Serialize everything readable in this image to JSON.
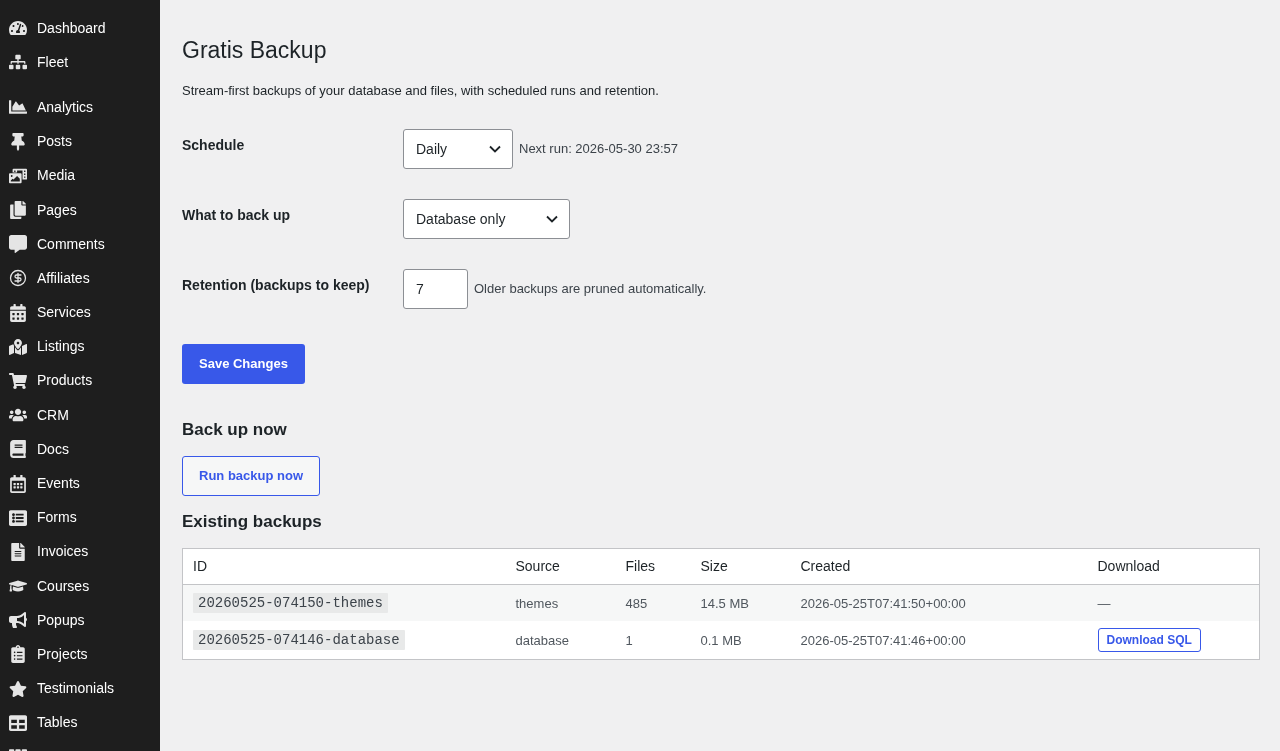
{
  "sidebar": {
    "groups": [
      {
        "items": [
          {
            "label": "Dashboard",
            "selected": false
          },
          {
            "label": "Fleet",
            "selected": false
          }
        ]
      },
      {
        "items": [
          {
            "label": "Analytics",
            "selected": false
          },
          {
            "label": "Posts",
            "selected": false
          },
          {
            "label": "Media",
            "selected": false
          },
          {
            "label": "Pages",
            "selected": false
          },
          {
            "label": "Comments",
            "selected": false
          },
          {
            "label": "Affiliates",
            "selected": false
          },
          {
            "label": "Services",
            "selected": false
          },
          {
            "label": "Listings",
            "selected": false
          },
          {
            "label": "Products",
            "selected": false
          },
          {
            "label": "CRM",
            "selected": false
          },
          {
            "label": "Docs",
            "selected": false
          },
          {
            "label": "Events",
            "selected": false
          },
          {
            "label": "Forms",
            "selected": false
          },
          {
            "label": "Invoices",
            "selected": false
          },
          {
            "label": "Courses",
            "selected": false
          },
          {
            "label": "Popups",
            "selected": false
          },
          {
            "label": "Projects",
            "selected": false
          },
          {
            "label": "Testimonials",
            "selected": false
          },
          {
            "label": "Tables",
            "selected": false
          }
        ]
      }
    ]
  },
  "page": {
    "title": "Gratis Backup",
    "description": "Stream-first backups of your database and files, with scheduled runs and retention.",
    "settings": [
      {
        "label": "Schedule",
        "kind": "select",
        "value": "Daily",
        "note": "Next run: 2026-05-30 23:57"
      },
      {
        "label": "What to back up",
        "kind": "select",
        "value": "Database only"
      },
      {
        "label": "Retention (backups to keep)",
        "kind": "number",
        "value": "7",
        "note": "Older backups are pruned automatically."
      }
    ],
    "save_button": "Save Changes",
    "backup_now": {
      "heading": "Back up now",
      "button": "Run backup now"
    },
    "existing_backups": {
      "heading": "Existing backups",
      "table": {
        "columns": [
          "ID",
          "Source",
          "Files",
          "Size",
          "Created",
          "Download"
        ],
        "rows": [
          {
            "id": "20260525-074150-themes",
            "source": "themes",
            "files": "485",
            "size": "14.5 MB",
            "created": "2026-05-25T07:41:50+00:00",
            "download": {
              "kind": "text",
              "text": "—"
            }
          },
          {
            "id": "20260525-074146-database",
            "source": "database",
            "files": "1",
            "size": "0.1 MB",
            "created": "2026-05-25T07:41:46+00:00",
            "download": {
              "kind": "button",
              "text": "Download SQL"
            }
          }
        ]
      }
    }
  }
}
